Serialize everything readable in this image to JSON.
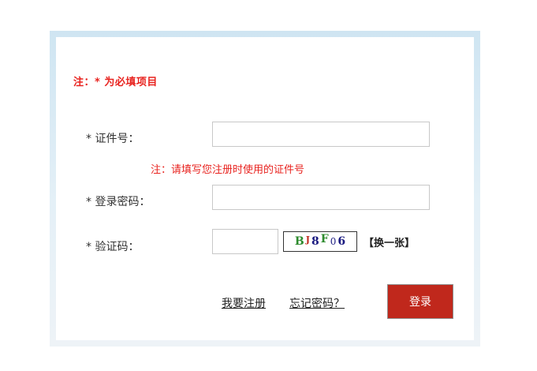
{
  "form": {
    "required_note": "注：* 为必填项目",
    "id_label": "* 证件号：",
    "id_value": "",
    "id_hint": "注：请填写您注册时使用的证件号",
    "password_label": "* 登录密码：",
    "password_value": "",
    "code_label": "* 验证码：",
    "code_value": "",
    "captcha_chars": [
      {
        "char": "B",
        "color": "#2e8b2e"
      },
      {
        "char": "J",
        "color": "#c0281c"
      },
      {
        "char": "8",
        "color": "#1a1a80"
      },
      {
        "char": "F",
        "color": "#2e8b2e"
      },
      {
        "char": "0",
        "color": "#1a1a80"
      },
      {
        "char": "6",
        "color": "#1a1a80"
      }
    ],
    "refresh_label": "【换一张】"
  },
  "footer": {
    "register_link": "我要注册",
    "forgot_link": "忘记密码？",
    "login_button": "登录"
  },
  "colors": {
    "accent_red": "#e8231f",
    "button_red": "#c0281c",
    "frame_blue": "#cfe5f2"
  }
}
